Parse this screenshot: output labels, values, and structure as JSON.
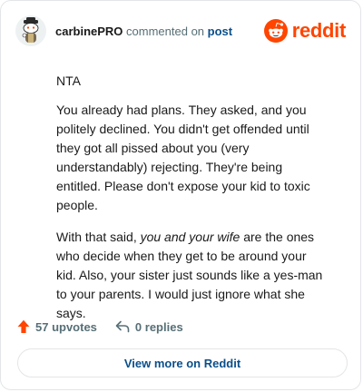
{
  "header": {
    "username": "carbinePRO",
    "commented_text": "commented on",
    "post_link": "post",
    "brand": "reddit",
    "colors": {
      "brand": "#ff4500",
      "link": "#0a4f8a",
      "muted": "#576f76"
    },
    "avatar_icon": "snoo-avatar-icon",
    "logo_icon": "reddit-alien-icon"
  },
  "comment": {
    "p1": "NTA",
    "p2": "You already had plans. They asked, and you politely declined. You didn't get offended until they got all pissed about you (very understandably) rejecting. They're being entitled. Please don't expose your kid to toxic people.",
    "p3_before": "With that said, ",
    "p3_emphasis": "you and your wife",
    "p3_after": " are the ones who decide when they get to be around your kid. Also, your sister just sounds like a yes-man to your parents. I would just ignore what she says."
  },
  "footer": {
    "upvotes": "57 upvotes",
    "replies": "0 replies",
    "upvote_icon": "upvote-arrow-icon",
    "reply_icon": "reply-icon"
  },
  "cta": {
    "label": "View more on Reddit"
  }
}
